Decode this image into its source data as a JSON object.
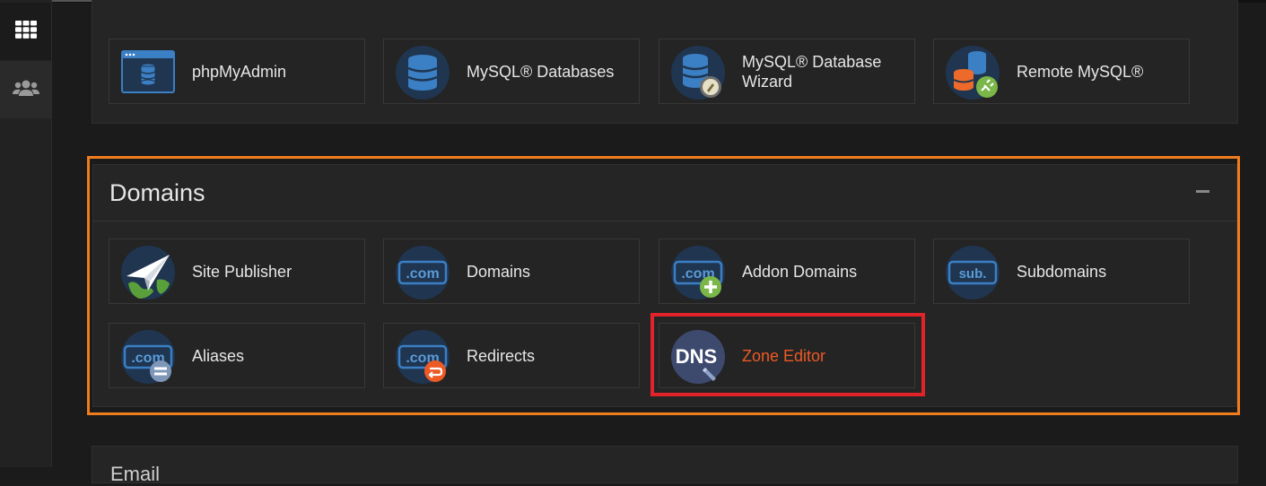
{
  "sidebar": {
    "items": [
      {
        "icon": "grid-icon",
        "active": true
      },
      {
        "icon": "users-icon",
        "active": false
      }
    ]
  },
  "databases": {
    "tiles": [
      {
        "label": "phpMyAdmin",
        "icon": "phpmyadmin-icon"
      },
      {
        "label": "MySQL® Databases",
        "icon": "mysql-databases-icon"
      },
      {
        "label": "MySQL® Database Wizard",
        "icon": "mysql-wizard-icon"
      },
      {
        "label": "Remote MySQL®",
        "icon": "remote-mysql-icon"
      }
    ]
  },
  "domains": {
    "title": "Domains",
    "tiles": [
      {
        "label": "Site Publisher",
        "icon": "site-publisher-icon"
      },
      {
        "label": "Domains",
        "icon": "domains-icon",
        "icon_text": ".com"
      },
      {
        "label": "Addon Domains",
        "icon": "addon-domains-icon",
        "icon_text": ".com"
      },
      {
        "label": "Subdomains",
        "icon": "subdomains-icon",
        "icon_text": "sub."
      },
      {
        "label": "Aliases",
        "icon": "aliases-icon",
        "icon_text": ".com"
      },
      {
        "label": "Redirects",
        "icon": "redirects-icon",
        "icon_text": ".com"
      },
      {
        "label": "Zone Editor",
        "icon": "dns-zone-editor-icon",
        "icon_text": "DNS",
        "highlighted": true
      }
    ]
  },
  "next_section": {
    "title": "Email"
  },
  "colors": {
    "background": "#1b1b1b",
    "panel": "#252525",
    "orange_highlight": "#f07c1e",
    "red_highlight": "#e2232a",
    "accent_text": "#ee5a24",
    "icon_circle": "#1f3550",
    "icon_blue": "#3b7fc4"
  }
}
